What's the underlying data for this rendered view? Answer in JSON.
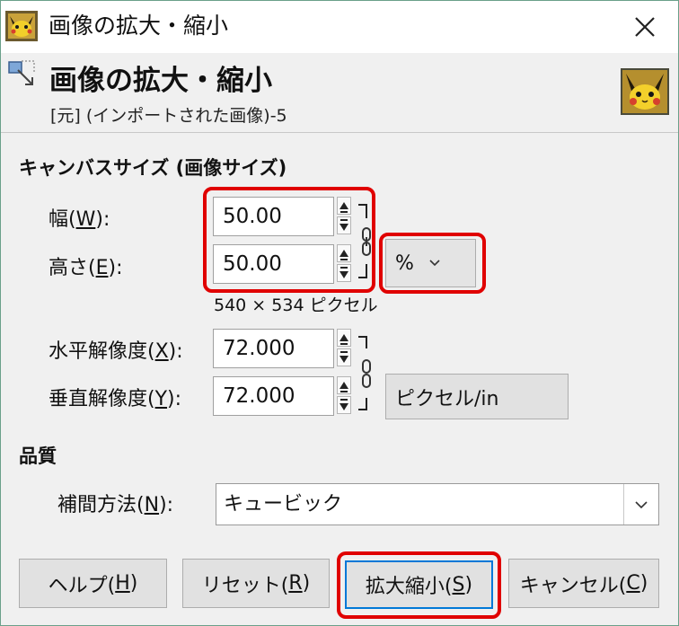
{
  "window": {
    "title": "画像の拡大・縮小",
    "close_glyph": "✕"
  },
  "header": {
    "title": "画像の拡大・縮小",
    "subtitle": "[元] (インポートされた画像)-5"
  },
  "canvas_size": {
    "section_title": "キャンバスサイズ (画像サイズ)",
    "width_label": {
      "text": "幅(",
      "key": "W",
      "tail": "):"
    },
    "height_label": {
      "text": "高さ(",
      "key": "E",
      "tail": "):"
    },
    "width_value": "50.00",
    "height_value": "50.00",
    "unit": "%",
    "pixels_text": "540 × 534 ピクセル"
  },
  "resolution": {
    "x_label": {
      "text": "水平解像度(",
      "key": "X",
      "tail": "):"
    },
    "y_label": {
      "text": "垂直解像度(",
      "key": "Y",
      "tail": "):"
    },
    "x_value": "72.000",
    "y_value": "72.000",
    "unit": "ピクセル/in"
  },
  "quality": {
    "section_title": "品質",
    "interp_label": {
      "text": "補間方法(",
      "key": "N",
      "tail": "):"
    },
    "interp_value": "キュービック"
  },
  "buttons": {
    "help": {
      "text": "ヘルプ(",
      "key": "H",
      "tail": ")"
    },
    "reset": {
      "text": "リセット(",
      "key": "R",
      "tail": ")"
    },
    "scale": {
      "text": "拡大縮小(",
      "key": "S",
      "tail": ")"
    },
    "cancel": {
      "text": "キャンセル(",
      "key": "C",
      "tail": ")"
    }
  },
  "icons": [
    "pikachu-thumbnail-icon",
    "scale-image-icon",
    "close-icon",
    "chain-link-icon",
    "chevron-down-icon",
    "spin-up-icon",
    "spin-down-icon"
  ],
  "colors": {
    "highlight": "#e00000",
    "accent_border": "#6aa08a"
  }
}
